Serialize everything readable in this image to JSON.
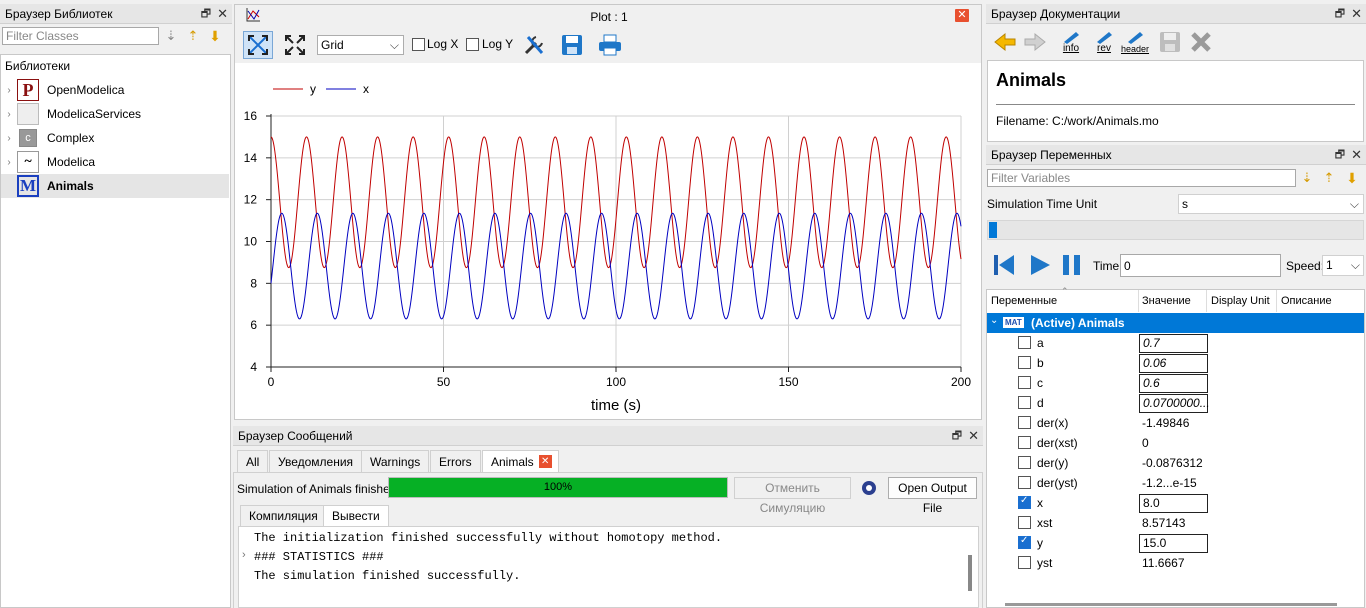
{
  "library_browser": {
    "title": "Браузер Библиотек",
    "filter_placeholder": "Filter Classes",
    "libraries_label": "Библиотеки",
    "items": [
      {
        "label": "OpenModelica",
        "icon": "P"
      },
      {
        "label": "ModelicaServices",
        "icon": ""
      },
      {
        "label": "Complex",
        "icon": "c"
      },
      {
        "label": "Modelica",
        "icon": "~"
      },
      {
        "label": "Animals",
        "icon": "M"
      }
    ]
  },
  "plot_window": {
    "title": "Plot : 1",
    "grid_select": "Grid",
    "log_x": "Log X",
    "log_y": "Log Y"
  },
  "chart_data": {
    "type": "line",
    "xlabel": "time (s)",
    "ylabel": "",
    "xlim": [
      0,
      200
    ],
    "ylim": [
      4,
      16
    ],
    "x_ticks": [
      "0",
      "50",
      "100",
      "150",
      "200"
    ],
    "y_ticks": [
      "4",
      "6",
      "8",
      "10",
      "12",
      "14",
      "16"
    ],
    "grid": true,
    "legend_position": "top-left",
    "series": [
      {
        "name": "y",
        "color": "#c00000",
        "t0": 0,
        "period": 10.3,
        "max": 15.0,
        "min": 8.75,
        "y0": 15.0
      },
      {
        "name": "x",
        "color": "#0000c0",
        "t0": 0,
        "period": 10.3,
        "max": 11.35,
        "min": 6.3,
        "y0": 8.0
      }
    ]
  },
  "doc_browser": {
    "title": "Браузер Документации",
    "heading": "Animals",
    "filename": "Filename: C:/work/Animals.mo",
    "toolbar": {
      "info": "info",
      "rev": "rev",
      "header": "header"
    }
  },
  "var_browser": {
    "title": "Браузер Переменных",
    "filter_placeholder": "Filter Variables",
    "sim_time_unit_label": "Simulation Time Unit",
    "sim_time_unit_value": "s",
    "time_label": "Time:",
    "time_value": "0",
    "speed_label": "Speed:",
    "speed_value": "1",
    "columns": [
      "Переменные",
      "Значение",
      "Display Unit",
      "Описание"
    ],
    "root_badge": "MAT",
    "root_label": "(Active) Animals",
    "rows": [
      {
        "name": "a",
        "value": "0.7",
        "editable": true,
        "checked": false
      },
      {
        "name": "b",
        "value": "0.06",
        "editable": true,
        "checked": false
      },
      {
        "name": "c",
        "value": "0.6",
        "editable": true,
        "checked": false
      },
      {
        "name": "d",
        "value": "0.0700000...",
        "editable": true,
        "checked": false
      },
      {
        "name": "der(x)",
        "value": "-1.49846",
        "editable": false,
        "checked": false
      },
      {
        "name": "der(xst)",
        "value": "0",
        "editable": false,
        "checked": false
      },
      {
        "name": "der(y)",
        "value": "-0.0876312",
        "editable": false,
        "checked": false
      },
      {
        "name": "der(yst)",
        "value": "-1.2...e-15",
        "editable": false,
        "checked": false
      },
      {
        "name": "x",
        "value": "8.0",
        "editable": true,
        "checked": true
      },
      {
        "name": "xst",
        "value": "8.57143",
        "editable": false,
        "checked": false
      },
      {
        "name": "y",
        "value": "15.0",
        "editable": true,
        "checked": true
      },
      {
        "name": "yst",
        "value": "11.6667",
        "editable": false,
        "checked": false
      }
    ]
  },
  "messages": {
    "title": "Браузер Сообщений",
    "tabs": [
      "All",
      "Уведомления",
      "Warnings",
      "Errors",
      "Animals"
    ],
    "status_text": "Simulation of Animals finished.",
    "progress": 100,
    "progress_text": "100%",
    "cancel_button": "Отменить Симуляцию",
    "open_output_button": "Open Output File",
    "subtabs": [
      "Компиляция",
      "Вывести"
    ],
    "lines": [
      "The initialization finished successfully without homotopy method.",
      "### STATISTICS ###",
      "The simulation finished successfully."
    ]
  },
  "colors": {
    "progress": "#06b025",
    "selected_row": "#0078d7",
    "y_series": "#c00000",
    "x_series": "#0000c0"
  }
}
